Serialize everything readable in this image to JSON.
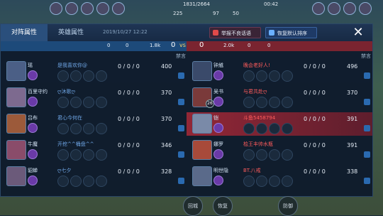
{
  "hud": {
    "score": "1831/2664",
    "timer": "00:42",
    "stats": [
      "225",
      "97",
      "50"
    ]
  },
  "tabs": [
    "对阵属性",
    "英雄属性"
  ],
  "datetime": "2019/10/27 12:22",
  "buttons": {
    "report": "举报不良话语",
    "restore": "恢复默认排序",
    "close": "✕"
  },
  "score": {
    "left": {
      "towers": "0",
      "dragons": "0",
      "gold": "1.8k",
      "kills": "0"
    },
    "vs": "vs",
    "right": {
      "kills": "0",
      "gold": "2.0k",
      "towers": "0",
      "dragons": "0"
    }
  },
  "colhead": {
    "left_chat": "禁言",
    "right_chat": "禁言"
  },
  "left_team": [
    {
      "player": "瑶",
      "game_name": "是我喜欢你@",
      "kda": "0 / 0 / 0",
      "gold": "400",
      "level": "",
      "avatar_color": "#4b5f86"
    },
    {
      "player": "百里守约",
      "game_name": "ღ沐歌ღ",
      "kda": "0 / 0 / 0",
      "gold": "370",
      "level": "",
      "avatar_color": "#7d6a8f"
    },
    {
      "player": "吕布",
      "game_name": "君心今何在",
      "kda": "0 / 0 / 0",
      "gold": "370",
      "level": "",
      "avatar_color": "#9c5a3a"
    },
    {
      "player": "牛魔",
      "game_name": "开挖^^桶盘^^",
      "kda": "0 / 0 / 0",
      "gold": "346",
      "level": "",
      "avatar_color": "#8a4c6a"
    },
    {
      "player": "貂蝉",
      "game_name": "ღ七夕",
      "kda": "0 / 0 / 0",
      "gold": "328",
      "level": "",
      "avatar_color": "#6b5a7a"
    }
  ],
  "right_team": [
    {
      "player": "钟馗",
      "game_name": "晚会老好人!",
      "kda": "0 / 0 / 0",
      "gold": "496",
      "level": "",
      "avatar_color": "#3a4a6a"
    },
    {
      "player": "吴书",
      "game_name": "与君共赴ღ",
      "kda": "0 / 0 / 0",
      "gold": "370",
      "level": "26",
      "avatar_color": "#7a3a3a"
    },
    {
      "player": "铠",
      "game_name": "斗鱼5458794",
      "kda": "0 / 0 / 0",
      "gold": "391",
      "level": "",
      "avatar_color": "#7a8aa8",
      "highlight": true
    },
    {
      "player": "娜罗",
      "game_name": "桧王丰帅水瓶",
      "kda": "0 / 0 / 0",
      "gold": "391",
      "level": "",
      "avatar_color": "#a84a3a"
    },
    {
      "player": "明世隐",
      "game_name": "BT.八戒",
      "kda": "0 / 0 / 0",
      "gold": "338",
      "level": "",
      "avatar_color": "#5a6a8a"
    }
  ],
  "bottom_buttons": [
    "回城",
    "恢复",
    "防御"
  ],
  "colors": {
    "blue_team": "#1d4a7a",
    "red_team": "#7a2430",
    "highlight": "#a02837"
  }
}
